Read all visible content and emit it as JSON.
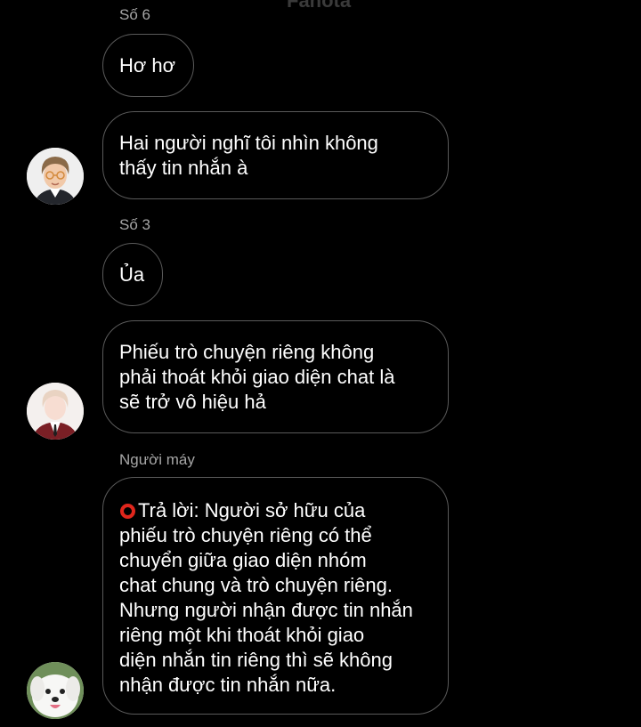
{
  "header": {
    "title": "Fanota"
  },
  "messages": [
    {
      "sender": "Số 6",
      "text": "Hơ hơ"
    },
    {
      "sender": "",
      "text": "Hai người nghĩ tôi nhìn không\nthấy tin nhắn à",
      "avatar": "boy-glasses-avatar"
    },
    {
      "sender": "Số 3",
      "text": "Ủa"
    },
    {
      "sender": "",
      "text": "Phiếu trò chuyện riêng không\nphải thoát khỏi giao diện chat là\nsẽ trở vô hiệu hả",
      "avatar": "boy-uniform-avatar"
    },
    {
      "sender": "Người máy",
      "text": "Trả lời: Người sở hữu của\nphiếu trò chuyện riêng có thể\nchuyển giữa giao diện nhóm\nchat chung và trò chuyện riêng.\nNhưng người nhận được tin nhắn\nriêng một khi thoát khỏi giao\ndiện nhắn tin riêng thì sẽ không\nnhận được tin nhắn nữa.",
      "avatar": "dog-avatar",
      "icon": "red-circle-icon"
    }
  ],
  "colors": {
    "background": "#000000",
    "bubble_border": "#5a5a5a",
    "sender_name": "#a6a6a6",
    "reply_icon": "#e0261c"
  }
}
